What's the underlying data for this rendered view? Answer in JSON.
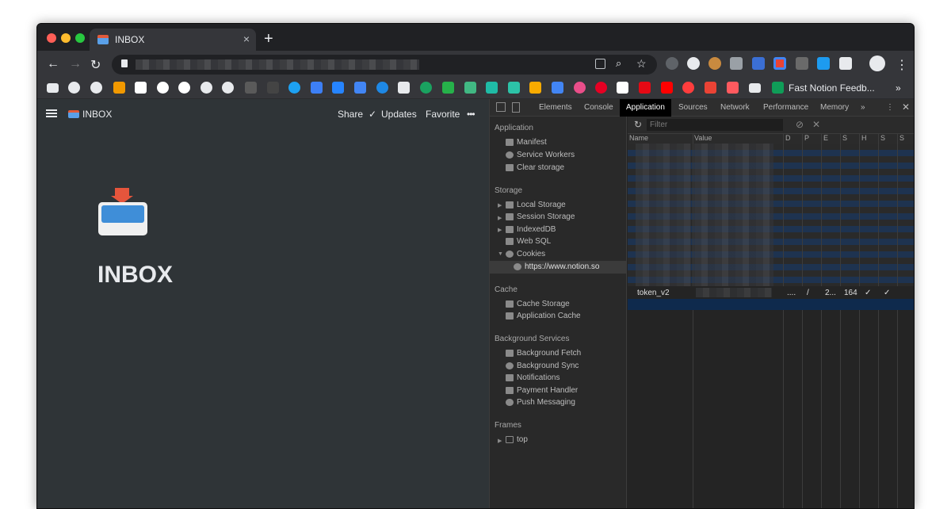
{
  "tab": {
    "title": "INBOX",
    "close": "×"
  },
  "newtab": "+",
  "bookmarks": {
    "last_label": "Fast Notion Feedb...",
    "overflow": "»"
  },
  "notion": {
    "breadcrumb": "INBOX",
    "share": "Share",
    "updates": "Updates",
    "favorite": "Favorite",
    "more": "•••",
    "title": "INBOX"
  },
  "devtools": {
    "tabs": [
      "Elements",
      "Console",
      "Application",
      "Sources",
      "Network",
      "Performance",
      "Memory",
      "»"
    ],
    "active_tab": "Application",
    "sections": {
      "application": {
        "label": "Application",
        "items": [
          "Manifest",
          "Service Workers",
          "Clear storage"
        ]
      },
      "storage": {
        "label": "Storage",
        "items": [
          "Local Storage",
          "Session Storage",
          "IndexedDB",
          "Web SQL",
          "Cookies"
        ],
        "cookie_origin": "https://www.notion.so"
      },
      "cache": {
        "label": "Cache",
        "items": [
          "Cache Storage",
          "Application Cache"
        ]
      },
      "background": {
        "label": "Background Services",
        "items": [
          "Background Fetch",
          "Background Sync",
          "Notifications",
          "Payment Handler",
          "Push Messaging"
        ]
      },
      "frames": {
        "label": "Frames",
        "items": [
          "top"
        ]
      }
    },
    "filter_placeholder": "Filter",
    "columns": [
      "Name",
      "Value",
      "D",
      "P",
      "E",
      "S",
      "H",
      "S",
      "S"
    ],
    "cookie": {
      "name": "token_v2",
      "domain": "....",
      "path": "/",
      "expires": "2...",
      "size": "164",
      "http": "✓",
      "secure": "✓"
    }
  }
}
